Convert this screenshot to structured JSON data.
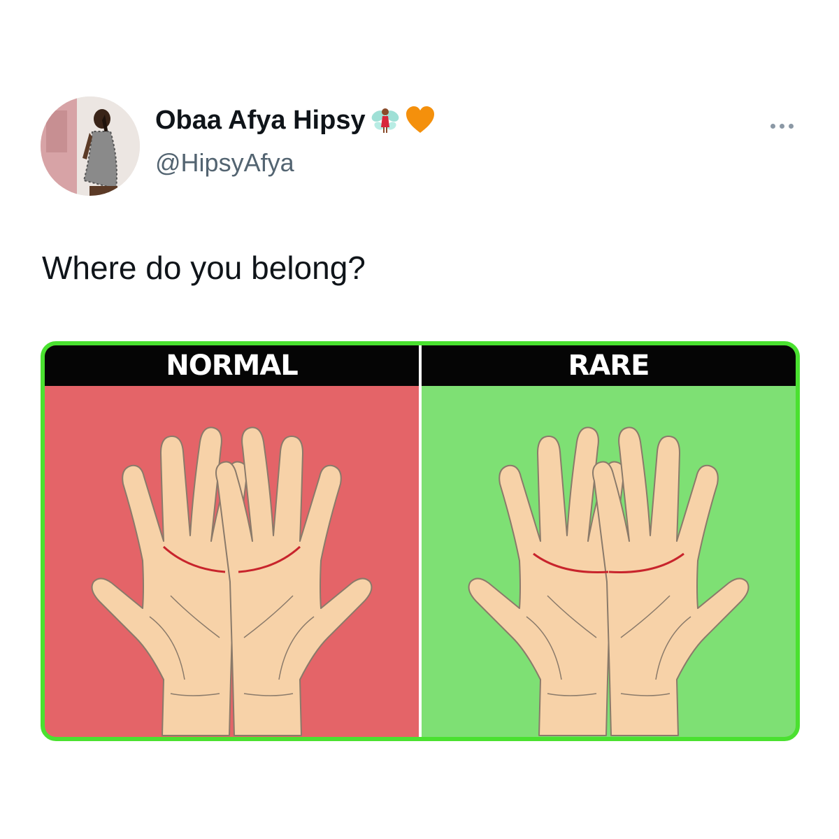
{
  "tweet": {
    "display_name": "Obaa Afya Hipsy",
    "name_emojis": [
      "fairy-emoji",
      "orange-heart-emoji"
    ],
    "handle": "@HipsyAfya",
    "text": "Where do you belong?"
  },
  "media": {
    "left_label": "NORMAL",
    "right_label": "RARE",
    "colors": {
      "frame": "#4ae130",
      "normal_bg": "#e46468",
      "rare_bg": "#7ee074",
      "label_bar": "#050505",
      "skin": "#f7d2a8",
      "palm_line": "#c8242c"
    }
  }
}
